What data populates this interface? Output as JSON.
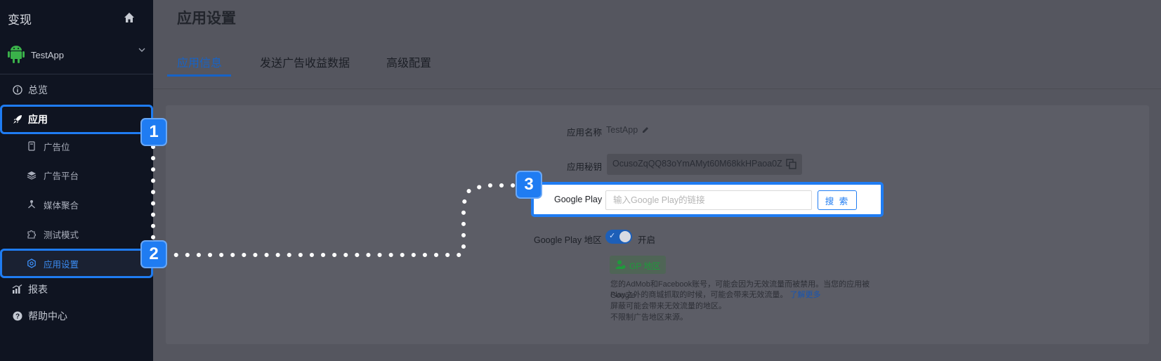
{
  "sidebar": {
    "brand": "变现",
    "app_name": "TestApp",
    "items": [
      {
        "label": "总览",
        "icon": "info-circle-icon"
      },
      {
        "label": "应用",
        "icon": "rocket-icon"
      },
      {
        "label": "广告位",
        "icon": "ad-slot-icon"
      },
      {
        "label": "广告平台",
        "icon": "layers-icon"
      },
      {
        "label": "媒体聚合",
        "icon": "mediation-icon"
      },
      {
        "label": "测试模式",
        "icon": "puzzle-icon"
      },
      {
        "label": "应用设置",
        "icon": "gear-icon"
      },
      {
        "label": "报表",
        "icon": "chart-icon"
      },
      {
        "label": "帮助中心",
        "icon": "help-icon"
      }
    ]
  },
  "header": {
    "title": "应用设置"
  },
  "tabs": [
    {
      "label": "应用信息"
    },
    {
      "label": "发送广告收益数据"
    },
    {
      "label": "高级配置"
    }
  ],
  "form": {
    "app_name_label": "应用名称",
    "app_name_value": "TestApp",
    "app_secret_label": "应用秘钥",
    "app_secret_value": "OcusoZqQQ83oYmAMyt60M68kkHPaoa0Z",
    "gp_label": "Google Play",
    "gp_placeholder": "输入Google Play的链接",
    "gp_search_button": "搜 索",
    "gp_region_label": "Google Play 地区",
    "gp_region_toggle_text": "开启",
    "gp_region_toggle_on": true,
    "gp_tag": "GP 地区",
    "desc_line1": "您的AdMob和Facebook账号，可能会因为无效流量而被禁用。当您的应用被Google",
    "desc_line2": "Play之外的商城抓取的时候，可能会带来无效流量。",
    "desc_link": "了解更多",
    "desc_line3": "屏蔽可能会带来无效流量的地区。",
    "desc_line4": "不限制广告地区来源。"
  },
  "annotations": {
    "step1": "1",
    "step2": "2",
    "step3": "3"
  },
  "colors": {
    "accent": "#1f7cf2",
    "sidebar_bg": "#0f1421",
    "active_link": "#1663c7",
    "tag_green": "#1e9b3b"
  }
}
